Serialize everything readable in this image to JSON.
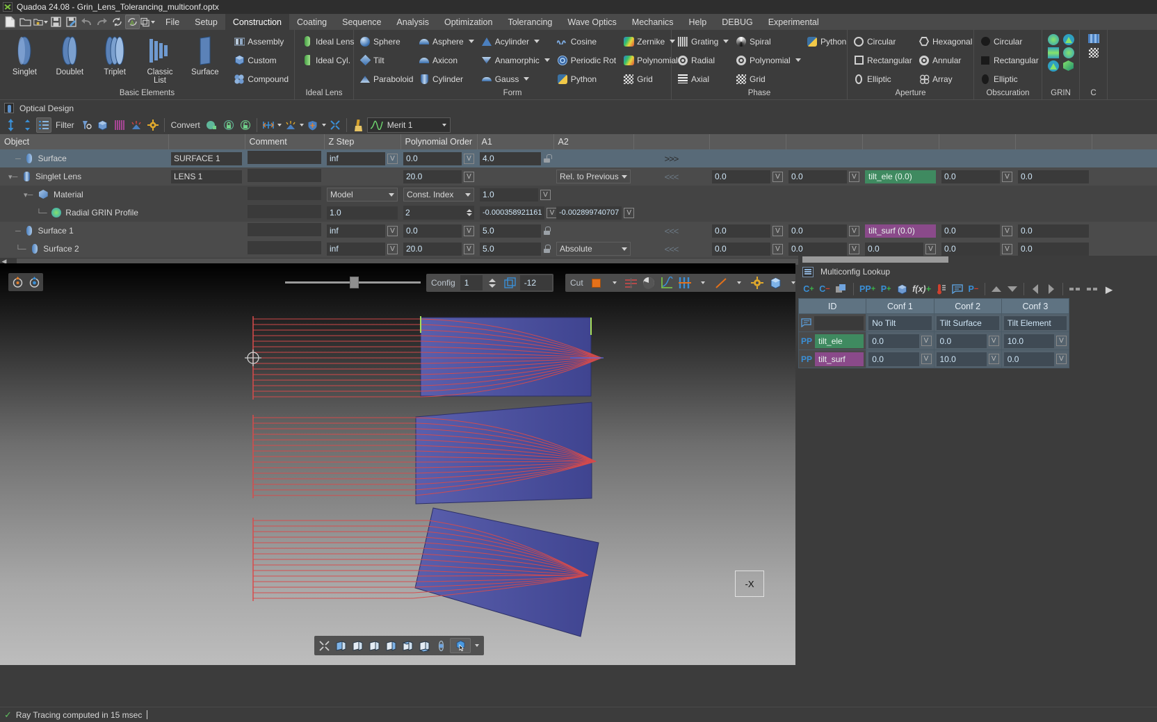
{
  "window": {
    "title": "Quadoa 24.08 - Grin_Lens_Tolerancing_multiconf.optx",
    "logo_icon": "quadoa-logo-icon"
  },
  "quick_access": [
    {
      "name": "new-file-button",
      "icon": "new-file-icon"
    },
    {
      "name": "open-file-button",
      "icon": "open-folder-icon"
    },
    {
      "name": "open-recent-button",
      "icon": "open-recent-folder-icon",
      "dropdown": true
    },
    {
      "name": "save-button",
      "icon": "save-disk-icon"
    },
    {
      "name": "save-as-button",
      "icon": "save-as-icon"
    },
    {
      "name": "undo-button",
      "icon": "undo-arrow-icon"
    },
    {
      "name": "redo-button",
      "icon": "redo-arrow-icon"
    },
    {
      "name": "refresh-button",
      "icon": "refresh-icon"
    },
    {
      "name": "auto-update-button",
      "icon": "auto-update-a-icon",
      "active": true
    },
    {
      "name": "window-layout-button",
      "icon": "window-copy-icon",
      "dropdown": true
    }
  ],
  "menu": {
    "items": [
      "File",
      "Setup",
      "Construction",
      "Coating",
      "Sequence",
      "Analysis",
      "Optimization",
      "Tolerancing",
      "Wave Optics",
      "Mechanics",
      "Help",
      "DEBUG",
      "Experimental"
    ],
    "active": "Construction"
  },
  "ribbon": {
    "groups": [
      {
        "label": "Basic Elements",
        "big_buttons": [
          {
            "label": "Singlet",
            "icon": "singlet-lens-icon"
          },
          {
            "label": "Doublet",
            "icon": "doublet-lens-icon"
          },
          {
            "label": "Triplet",
            "icon": "triplet-lens-icon"
          },
          {
            "label": "Classic\nList",
            "icon": "classic-list-icon"
          },
          {
            "label": "Surface",
            "icon": "surface-icon"
          }
        ],
        "small_buttons": [
          {
            "label": "Assembly",
            "icon": "assembly-icon"
          },
          {
            "label": "Custom",
            "icon": "custom-cube-icon"
          },
          {
            "label": "Compound",
            "icon": "compound-spheres-icon"
          }
        ]
      },
      {
        "label": "Ideal Lens",
        "small_buttons": [
          {
            "label": "Ideal Lens",
            "icon": "ideal-lens-icon"
          },
          {
            "label": "Ideal Cyl.",
            "icon": "ideal-cylinder-icon"
          }
        ]
      },
      {
        "label": "Form",
        "columns": [
          [
            {
              "label": "Sphere",
              "icon": "sphere-icon"
            },
            {
              "label": "Tilt",
              "icon": "tilt-icon"
            },
            {
              "label": "Paraboloid",
              "icon": "paraboloid-icon"
            }
          ],
          [
            {
              "label": "Asphere",
              "icon": "asphere-icon",
              "dropdown": true
            },
            {
              "label": "Axicon",
              "icon": "axicon-icon"
            },
            {
              "label": "Cylinder",
              "icon": "cylinder-icon"
            }
          ],
          [
            {
              "label": "Acylinder",
              "icon": "acylinder-icon",
              "dropdown": true
            },
            {
              "label": "Anamorphic",
              "icon": "anamorphic-icon",
              "dropdown": true
            },
            {
              "label": "Gauss",
              "icon": "gauss-icon",
              "dropdown": true
            }
          ],
          [
            {
              "label": "Cosine",
              "icon": "cosine-icon"
            },
            {
              "label": "Periodic Rot",
              "icon": "periodic-rotation-icon"
            },
            {
              "label": "Python",
              "icon": "python-icon"
            }
          ],
          [
            {
              "label": "Zernike",
              "icon": "zernike-icon",
              "dropdown": true
            },
            {
              "label": "Polynomial",
              "icon": "polynomial-icon"
            },
            {
              "label": "Grid",
              "icon": "grid-icon"
            }
          ]
        ]
      },
      {
        "label": "Phase",
        "columns": [
          [
            {
              "label": "Grating",
              "icon": "grating-icon",
              "dropdown": true
            },
            {
              "label": "Radial",
              "icon": "radial-phase-icon"
            },
            {
              "label": "Axial",
              "icon": "axial-phase-icon"
            }
          ],
          [
            {
              "label": "Spiral",
              "icon": "spiral-phase-icon"
            },
            {
              "label": "Polynomial",
              "icon": "polynomial-phase-icon",
              "dropdown": true
            },
            {
              "label": "Grid",
              "icon": "grid-phase-icon"
            }
          ],
          [
            {
              "label": "Python",
              "icon": "python-phase-icon"
            }
          ]
        ]
      },
      {
        "label": "Aperture",
        "columns": [
          [
            {
              "label": "Circular",
              "icon": "circle-outline-icon"
            },
            {
              "label": "Rectangular",
              "icon": "rectangle-outline-icon"
            },
            {
              "label": "Elliptic",
              "icon": "ellipse-outline-icon"
            }
          ],
          [
            {
              "label": "Hexagonal",
              "icon": "hexagon-outline-icon"
            },
            {
              "label": "Annular",
              "icon": "annulus-icon"
            },
            {
              "label": "Array",
              "icon": "array-icon"
            }
          ]
        ]
      },
      {
        "label": "Obscuration",
        "columns": [
          [
            {
              "label": "Circular",
              "icon": "circle-filled-icon"
            },
            {
              "label": "Rectangular",
              "icon": "rectangle-filled-icon"
            },
            {
              "label": "Elliptic",
              "icon": "ellipse-filled-icon"
            }
          ]
        ]
      },
      {
        "label": "GRIN",
        "icon_grid": [
          [
            "grin-radial-icon",
            "grin-left-icon"
          ],
          [
            "grin-axial-icon",
            "grin-right-icon"
          ],
          [
            "grin-cone-icon",
            "grin-cube-icon"
          ]
        ]
      },
      {
        "label": "C",
        "icon_grid": [
          [
            "coating-grid-icon"
          ],
          [
            "scatter-grid-icon"
          ]
        ]
      }
    ]
  },
  "optical_design": {
    "panel_title": "Optical Design",
    "panel_icon": "optical-design-tab-icon",
    "toolbar": {
      "filter_label": "Filter",
      "convert_label": "Convert",
      "merit_label": "Merit 1",
      "buttons": [
        {
          "name": "move-up-down-button",
          "icon": "move-vertical-icon"
        },
        {
          "name": "collapse-expand-button",
          "icon": "collapse-expand-icon"
        },
        {
          "name": "list-view-button",
          "icon": "list-view-icon",
          "active": true
        },
        {
          "name": "filter-surface-button",
          "icon": "filter-surface-icon"
        },
        {
          "name": "filter-material-button",
          "icon": "filter-material-icon"
        },
        {
          "name": "filter-grating-button",
          "icon": "filter-grating-icon"
        },
        {
          "name": "filter-source-button",
          "icon": "filter-source-icon"
        },
        {
          "name": "filter-settings-button",
          "icon": "filter-settings-gear-icon"
        },
        {
          "name": "convert-lock-button",
          "icon": "convert-lock-icon"
        },
        {
          "name": "lock-closed-button",
          "icon": "lock-closed-icon"
        },
        {
          "name": "lock-open-button",
          "icon": "lock-open-icon"
        },
        {
          "name": "distance-tool-button",
          "icon": "distance-tool-icon",
          "dropdown": true
        },
        {
          "name": "source-tool-button",
          "icon": "source-tool-icon",
          "dropdown": true
        },
        {
          "name": "shield-tool-button",
          "icon": "shield-tool-icon",
          "dropdown": true
        },
        {
          "name": "cross-tool-button",
          "icon": "cross-tool-icon"
        },
        {
          "name": "clean-tool-button",
          "icon": "broom-icon"
        }
      ]
    },
    "columns": [
      "Object",
      "",
      "Comment",
      "Z Step",
      "Polynomial Order",
      "A1",
      "A2",
      "",
      "",
      "",
      "",
      "",
      "",
      ""
    ],
    "rows": [
      {
        "state": "selected",
        "indent": 1,
        "icon": "surface-icon",
        "name": "Surface",
        "comment_name": "SURFACE 1",
        "comment": "",
        "zstep": "inf",
        "zstep_v": true,
        "poly_order": "0.0",
        "poly_v": true,
        "a1": "4.0",
        "a1_lock": "open",
        "a2": "",
        "chev": ">>>",
        "c1": "",
        "c2": "",
        "tag": "",
        "tag_type": "",
        "c3": "",
        "c4": ""
      },
      {
        "state": "alt",
        "indent": 0,
        "icon": "singlet-lens-icon",
        "name": "Singlet Lens",
        "comment_name": "LENS 1",
        "comment": "",
        "zstep": "",
        "zstep_v": false,
        "poly_order": "20.0",
        "poly_v": true,
        "a1": "",
        "a2_select": "Rel. to Previous",
        "chev": "<<<",
        "c1": "0.0",
        "c2": "0.0",
        "tag": "tilt_ele (0.0)",
        "tag_type": "green",
        "c3": "0.0",
        "c4": "0.0"
      },
      {
        "state": "norm",
        "indent": 2,
        "icon": "material-cube-icon",
        "name": "Material",
        "comment_name": "",
        "comment": "",
        "zstep_select": "Model",
        "poly_select": "Const. Index",
        "a1": "1.0",
        "a1_v": true,
        "a2": "",
        "chev": "",
        "c1": "",
        "c2": "",
        "tag": "",
        "c3": "",
        "c4": ""
      },
      {
        "state": "norm",
        "indent": 3,
        "icon": "radial-grin-profile-icon",
        "name": "Radial GRIN Profile",
        "comment_name": "",
        "comment": "",
        "zstep": "1.0",
        "poly_spin": "2",
        "a1": "-0.000358921161",
        "a1_v": true,
        "a2": "-0.002899740707",
        "a2_v": true,
        "chev": "",
        "c1": "",
        "c2": "",
        "tag": "",
        "c3": "",
        "c4": ""
      },
      {
        "state": "alt",
        "indent": 1,
        "icon": "surface-icon",
        "name": "Surface 1",
        "comment_name": "",
        "comment": "",
        "zstep": "inf",
        "zstep_v": true,
        "poly_order": "0.0",
        "poly_v": true,
        "a1": "5.0",
        "a1_lock": "closed",
        "a2": "",
        "chev": "<<<",
        "c1": "0.0",
        "c2": "0.0",
        "tag": "tilt_surf (0.0)",
        "tag_type": "purple",
        "c3": "0.0",
        "c4": "0.0"
      },
      {
        "state": "alt",
        "indent": 1,
        "icon": "surface-icon",
        "name": "Surface 2",
        "comment_name": "",
        "comment": "",
        "zstep": "inf",
        "zstep_v": true,
        "poly_order": "20.0",
        "poly_v": true,
        "a1": "5.0",
        "a1_lock": "closed",
        "a2_select": "Absolute",
        "chev": "<<<",
        "c1": "0.0",
        "c2": "0.0",
        "tag": "0.0",
        "tag_type": "plain",
        "c3": "0.0",
        "c4": "0.0"
      }
    ]
  },
  "viewport": {
    "toolbar_left": [
      {
        "name": "gizmo-move-button",
        "icon": "gizmo-move-icon"
      },
      {
        "name": "gizmo-rotate-button",
        "icon": "gizmo-rotate-icon"
      }
    ],
    "slider": {
      "name": "zoom-slider",
      "value": 48
    },
    "config": {
      "label": "Config",
      "value": "1"
    },
    "layers_icon": "layers-icon",
    "offset_value": "-12",
    "cut": {
      "label": "Cut",
      "color": "#e4711a"
    },
    "render_buttons": [
      {
        "name": "rays-visibility-button",
        "icon": "rays-lines-icon"
      },
      {
        "name": "aperture-stop-button",
        "icon": "aperture-iris-icon"
      },
      {
        "name": "plot-axes-button",
        "icon": "plot-axes-icon"
      },
      {
        "name": "grid-spacing-button",
        "icon": "grid-spacing-icon",
        "dropdown": true
      },
      {
        "name": "ray-color-button",
        "icon": "ray-color-line-icon",
        "dropdown": true
      },
      {
        "name": "render-settings-button",
        "icon": "render-settings-gear-icon"
      },
      {
        "name": "view-mode-button",
        "icon": "view-mode-cube-icon",
        "dropdown": true
      }
    ],
    "bottom_buttons": [
      {
        "name": "fit-view-button",
        "icon": "fit-view-icon"
      },
      {
        "name": "view-front-button",
        "icon": "cube-front-icon"
      },
      {
        "name": "view-back-button",
        "icon": "cube-back-icon"
      },
      {
        "name": "view-left-button",
        "icon": "cube-left-icon"
      },
      {
        "name": "view-right-button",
        "icon": "cube-right-icon"
      },
      {
        "name": "view-top-button",
        "icon": "cube-top-icon"
      },
      {
        "name": "view-bottom-button",
        "icon": "cube-bottom-icon"
      },
      {
        "name": "orbit-button",
        "icon": "orbit-icon"
      },
      {
        "name": "selection-mode-button",
        "icon": "selection-cube-icon",
        "dropdown": true
      }
    ],
    "axis_label": "-X",
    "accent_red": "#d84b4b",
    "lens_blue": "#4a4f9e"
  },
  "multiconfig": {
    "title": "Multiconfig Lookup",
    "panel_icon": "multiconfig-panel-icon",
    "toolbar": [
      {
        "name": "add-config-button",
        "icon": "add-config-icon"
      },
      {
        "name": "remove-config-button",
        "icon": "remove-config-icon"
      },
      {
        "name": "duplicate-config-button",
        "icon": "duplicate-config-icon"
      },
      {
        "name": "add-pickup-pair-button",
        "icon": "add-pickup-pair-icon"
      },
      {
        "name": "add-parameter-button",
        "icon": "add-parameter-icon"
      },
      {
        "name": "add-material-button",
        "icon": "add-material-icon"
      },
      {
        "name": "add-function-button",
        "icon": "add-function-icon"
      },
      {
        "name": "add-thermal-button",
        "icon": "add-thermal-icon"
      },
      {
        "name": "add-comment-button",
        "icon": "add-comment-icon"
      },
      {
        "name": "remove-parameter-button",
        "icon": "remove-parameter-icon"
      },
      {
        "name": "move-row-up-button",
        "icon": "arrow-up-icon"
      },
      {
        "name": "move-row-down-button",
        "icon": "arrow-down-icon"
      },
      {
        "name": "move-col-left-button",
        "icon": "arrow-left-icon"
      },
      {
        "name": "move-col-right-button",
        "icon": "arrow-right-icon"
      },
      {
        "name": "shift-left-button",
        "icon": "shift-left-icon"
      },
      {
        "name": "shift-right-button",
        "icon": "shift-right-icon"
      }
    ],
    "columns": [
      "ID",
      "Conf 1",
      "Conf 2",
      "Conf 3"
    ],
    "rows": [
      {
        "icon": "comment-icon",
        "id": "",
        "id_type": "plain",
        "values": [
          "No Tilt",
          "Tilt Surface",
          "Tilt Element"
        ],
        "value_type": "text"
      },
      {
        "icon": "pickup-pair-icon",
        "id": "tilt_ele",
        "id_type": "green",
        "values": [
          "0.0",
          "0.0",
          "10.0"
        ],
        "value_type": "number"
      },
      {
        "icon": "pickup-pair-icon",
        "id": "tilt_surf",
        "id_type": "purple",
        "values": [
          "0.0",
          "10.0",
          "0.0"
        ],
        "value_type": "number"
      }
    ]
  },
  "statusbar": {
    "icon": "status-ok-check-icon",
    "message": "Ray Tracing computed in 15 msec"
  }
}
